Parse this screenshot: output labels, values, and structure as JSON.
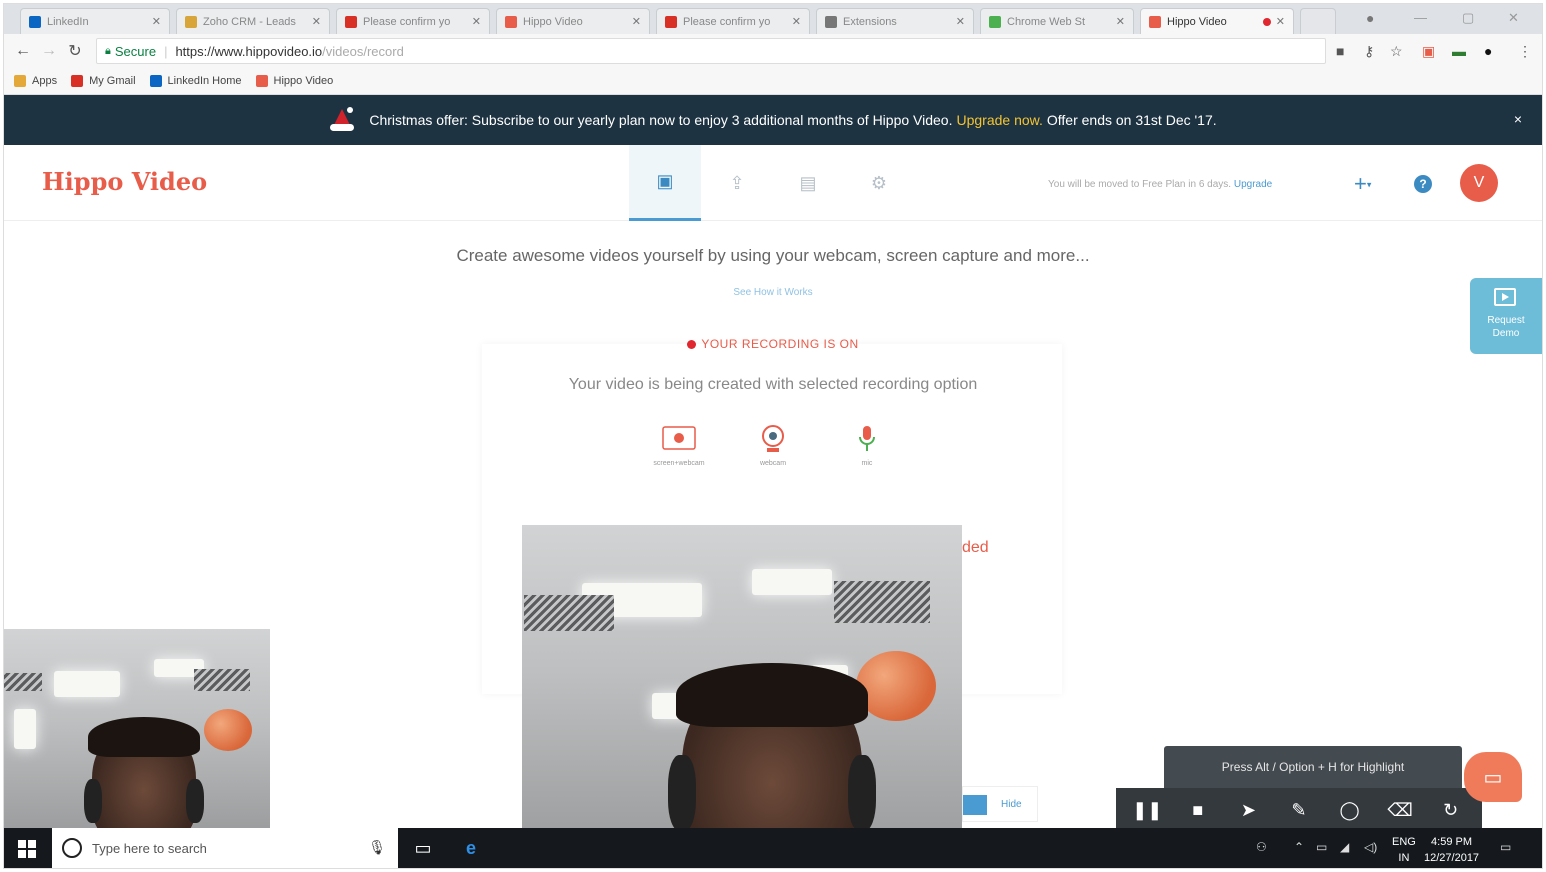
{
  "browser": {
    "tabs": [
      {
        "label": "LinkedIn",
        "favicon_color": "#0a66c2"
      },
      {
        "label": "Zoho CRM - Leads",
        "favicon_color": "#d7a53a"
      },
      {
        "label": "Please confirm yo",
        "favicon_color": "#d93025"
      },
      {
        "label": "Hippo Video",
        "favicon_color": "#e85c4a"
      },
      {
        "label": "Please confirm yo",
        "favicon_color": "#d93025"
      },
      {
        "label": "Extensions",
        "favicon_color": "#777777"
      },
      {
        "label": "Chrome Web St",
        "favicon_color": "#4caf50"
      },
      {
        "label": "Hippo Video",
        "favicon_color": "#e85c4a",
        "active": true
      }
    ],
    "secure_label": "Secure",
    "url_base": "https://www.hippovideo.io",
    "url_path": "/videos/record",
    "bookmarks": [
      {
        "label": "Apps",
        "color": "#e4a83a"
      },
      {
        "label": "My Gmail",
        "color": "#d93025"
      },
      {
        "label": "LinkedIn Home",
        "color": "#0a66c2"
      },
      {
        "label": "Hippo Video",
        "color": "#e85c4a"
      }
    ]
  },
  "banner": {
    "text_before": "Christmas offer: Subscribe to our yearly plan now to enjoy 3 additional months of Hippo Video.",
    "link": "Upgrade now.",
    "text_after": "Offer ends on 31st Dec '17.",
    "close": "×"
  },
  "header": {
    "logo": "Hippo Video",
    "trial_text": "You will be moved to Free Plan in 6 days.",
    "trial_link": "Upgrade",
    "avatar_letter": "V",
    "help_label": "?"
  },
  "main": {
    "tagline": "Create awesome videos yourself by using your webcam, screen capture and more...",
    "how_link": "See How it Works",
    "rec_status": "YOUR RECORDING IS ON",
    "creating_text": "Your video is being created with selected recording option",
    "options": [
      {
        "label": "screen+webcam"
      },
      {
        "label": "webcam"
      },
      {
        "label": "mic"
      }
    ],
    "partial_text": "ded",
    "hide_label": "Hide"
  },
  "request_demo": {
    "line1": "Request",
    "line2": "Demo"
  },
  "recorder": {
    "hint": "Press Alt / Option + H for Highlight"
  },
  "taskbar": {
    "search_placeholder": "Type here to search",
    "lang1": "ENG",
    "lang2": "IN",
    "time": "4:59 PM",
    "date": "12/27/2017"
  },
  "colors": {
    "banner_bg": "#1d3342",
    "brand": "#e85c4a",
    "accent": "#3b8bc2",
    "upgrade_link": "#f4c430",
    "recording_dot": "#e0262e"
  }
}
